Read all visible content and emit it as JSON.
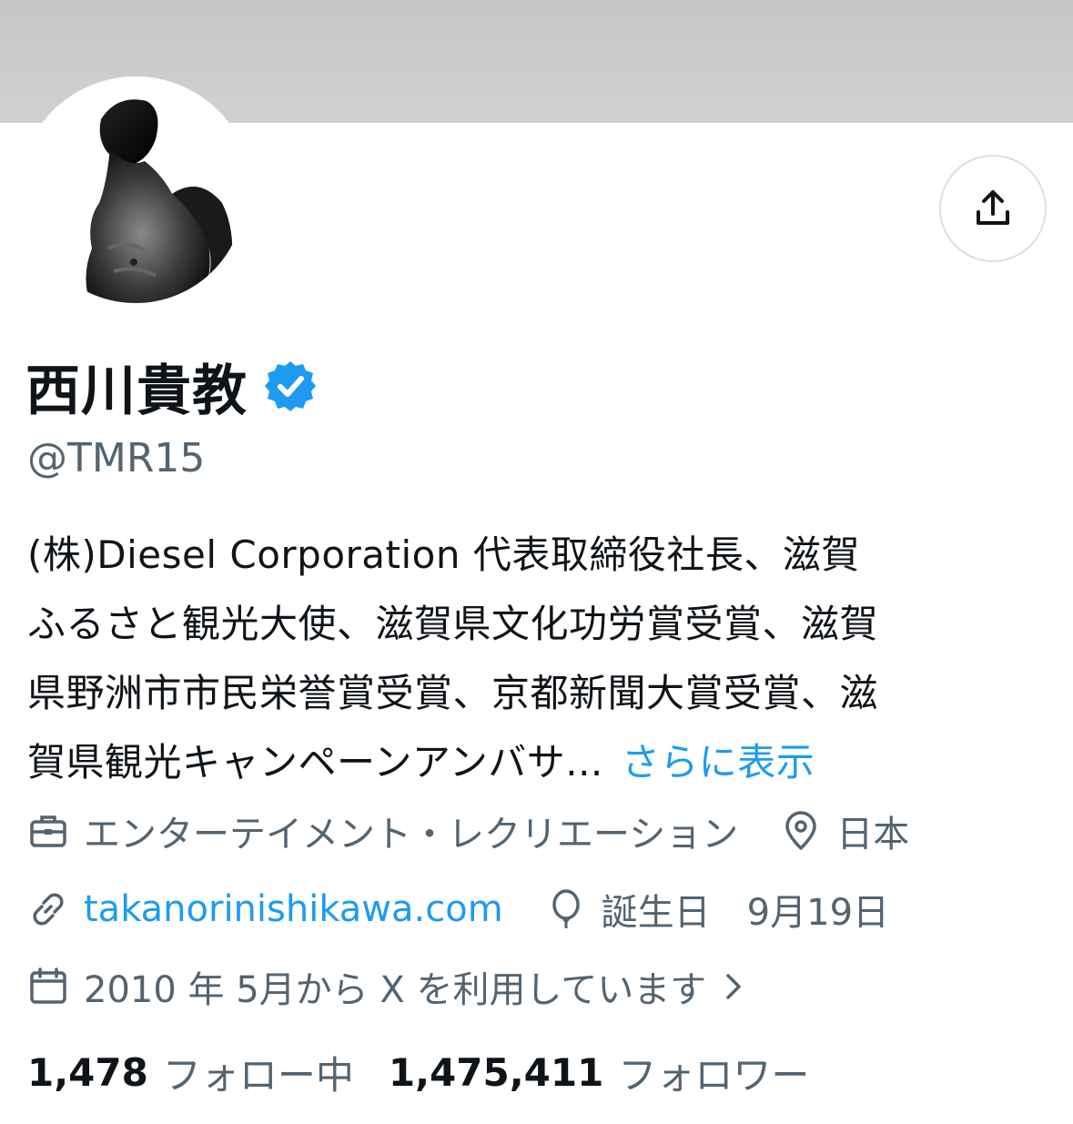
{
  "profile": {
    "display_name": "西川貴教",
    "handle": "@TMR15",
    "verified_icon": "verified-badge-icon",
    "bio_lines": [
      "(株)Diesel Corporation 代表取締役社長、滋賀",
      "ふるさと観光大使、滋賀県文化功労賞受賞、滋賀",
      "県野洲市市民栄誉賞受賞、京都新聞大賞受賞、滋",
      "賀県観光キャンペーンアンバサ..."
    ],
    "bio_more": "さらに表示",
    "category": "エンターテイメント・レクリエーション",
    "location": "日本",
    "website": "takanorinishikawa.com",
    "birthday": "誕生日　9月19日",
    "joined": "2010 年 5月から X を利用しています",
    "following_count": "1,478",
    "following_label": "フォロー中",
    "followers_count": "1,475,411",
    "followers_label": "フォロワー"
  },
  "icons": {
    "share": "share-icon",
    "category": "briefcase-icon",
    "location": "location-pin-icon",
    "link": "link-icon",
    "birthday": "balloon-icon",
    "joined": "calendar-icon",
    "chevron": "chevron-right-icon"
  },
  "colors": {
    "accent": "#1d9bf0",
    "secondary_text": "#536471",
    "primary_text": "#0f1419",
    "banner": "#c8c8c8"
  }
}
